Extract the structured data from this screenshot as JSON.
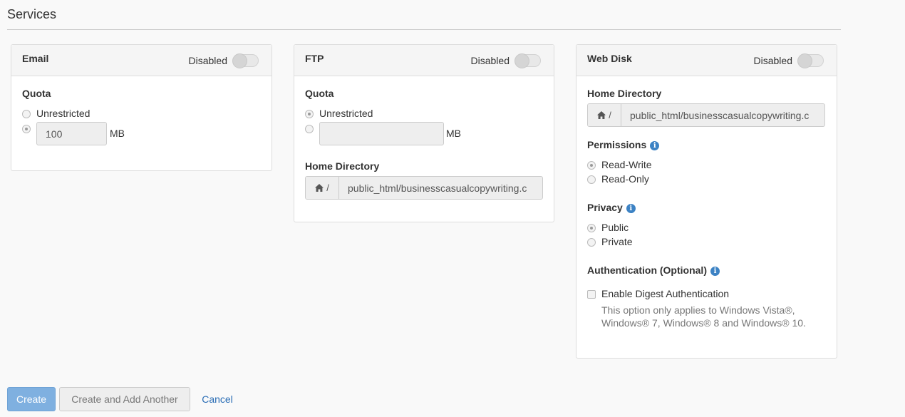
{
  "page": {
    "title": "Services"
  },
  "email": {
    "title": "Email",
    "toggle_label": "Disabled",
    "quota_label": "Quota",
    "unrestricted_label": "Unrestricted",
    "quota_value": "100",
    "unit": "MB"
  },
  "ftp": {
    "title": "FTP",
    "toggle_label": "Disabled",
    "quota_label": "Quota",
    "unrestricted_label": "Unrestricted",
    "quota_value": "",
    "unit": "MB",
    "home_label": "Home Directory",
    "home_prefix": "/",
    "home_value": "public_html/businesscasualcopywriting.c"
  },
  "webdisk": {
    "title": "Web Disk",
    "toggle_label": "Disabled",
    "home_label": "Home Directory",
    "home_prefix": "/",
    "home_value": "public_html/businesscasualcopywriting.c",
    "permissions_label": "Permissions",
    "perm_rw": "Read-Write",
    "perm_ro": "Read-Only",
    "privacy_label": "Privacy",
    "privacy_public": "Public",
    "privacy_private": "Private",
    "auth_label": "Authentication (Optional)",
    "digest_label": "Enable Digest Authentication",
    "help_line1": "This option only applies to Windows Vista®,",
    "help_line2": "Windows® 7, Windows® 8 and Windows® 10."
  },
  "actions": {
    "create": "Create",
    "create_another": "Create and Add Another",
    "cancel": "Cancel"
  },
  "icons": {
    "home": "home-icon",
    "info": "info-icon"
  },
  "colors": {
    "primary": "#7fb0e0",
    "link": "#2a6db5",
    "info": "#3c82c4"
  }
}
